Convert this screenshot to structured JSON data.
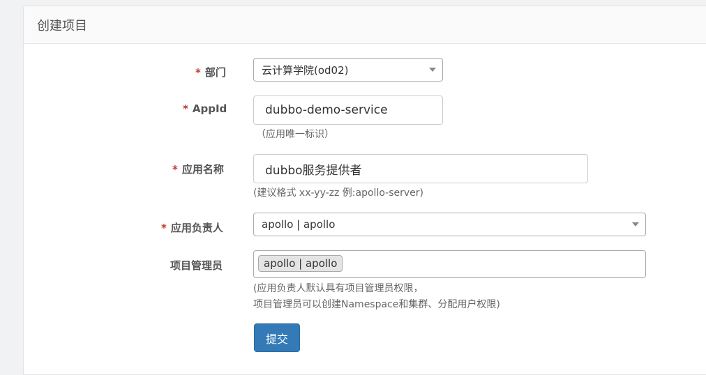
{
  "panel": {
    "title": "创建项目"
  },
  "form": {
    "department": {
      "label": "部门",
      "required": "*",
      "value": "云计算学院(od02)"
    },
    "appid": {
      "label": "AppId",
      "required": "*",
      "value": "dubbo-demo-service",
      "help": "（应用唯一标识）"
    },
    "app_name": {
      "label": "应用名称",
      "required": "*",
      "value": "dubbo服务提供者",
      "help": "(建议格式 xx-yy-zz 例:apollo-server)"
    },
    "owner": {
      "label": "应用负责人",
      "required": "*",
      "value": "apollo | apollo"
    },
    "admins": {
      "label": "项目管理员",
      "tags": [
        "apollo | apollo"
      ],
      "help_line1": "(应用负责人默认具有项目管理员权限，",
      "help_line2": "项目管理员可以创建Namespace和集群、分配用户权限)"
    },
    "submit_label": "提交"
  }
}
